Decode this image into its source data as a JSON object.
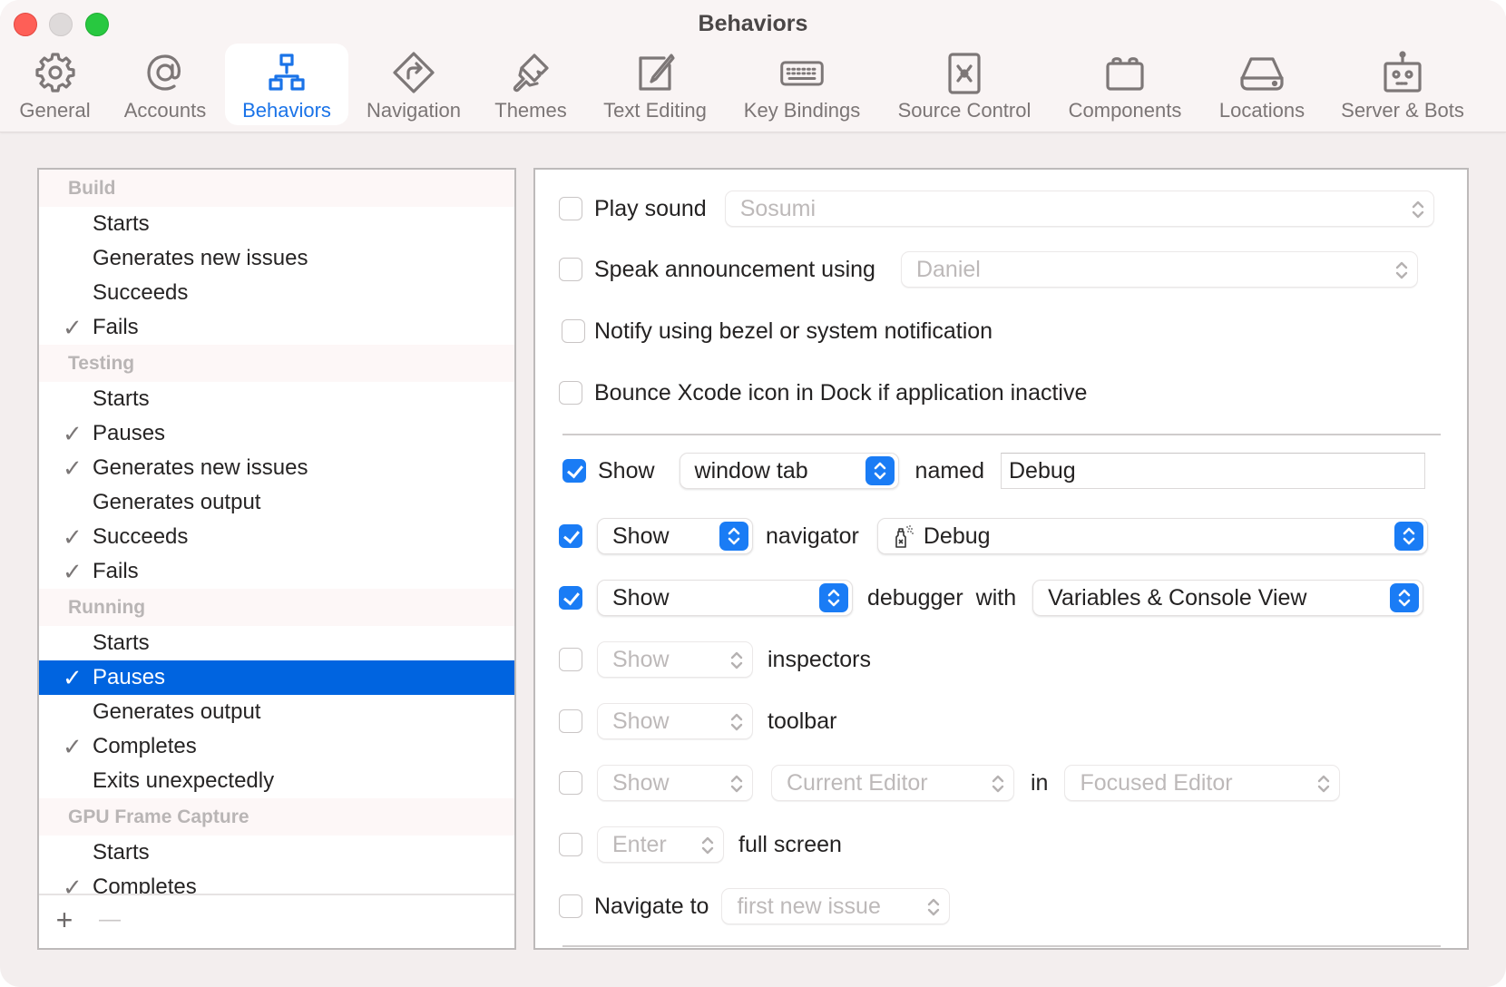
{
  "window": {
    "title": "Behaviors",
    "traffic_lights": [
      "close",
      "minimize",
      "zoom"
    ]
  },
  "toolbar": {
    "tabs": [
      {
        "label": "General",
        "icon": "gear-icon",
        "active": false
      },
      {
        "label": "Accounts",
        "icon": "at-sign-icon",
        "active": false
      },
      {
        "label": "Behaviors",
        "icon": "hierarchy-icon",
        "active": true
      },
      {
        "label": "Navigation",
        "icon": "directions-sign-icon",
        "active": false
      },
      {
        "label": "Themes",
        "icon": "paintbrush-icon",
        "active": false
      },
      {
        "label": "Text Editing",
        "icon": "square-pencil-icon",
        "active": false
      },
      {
        "label": "Key Bindings",
        "icon": "keyboard-icon",
        "active": false
      },
      {
        "label": "Source Control",
        "icon": "source-control-icon",
        "active": false
      },
      {
        "label": "Components",
        "icon": "components-icon",
        "active": false
      },
      {
        "label": "Locations",
        "icon": "drive-icon",
        "active": false
      },
      {
        "label": "Server & Bots",
        "icon": "robot-icon",
        "active": false
      }
    ],
    "accent_color": "#1a73e8"
  },
  "sidebar": {
    "groups": [
      {
        "header": "Build",
        "items": [
          {
            "label": "Starts",
            "checked": false
          },
          {
            "label": "Generates new issues",
            "checked": false
          },
          {
            "label": "Succeeds",
            "checked": false
          },
          {
            "label": "Fails",
            "checked": true
          }
        ]
      },
      {
        "header": "Testing",
        "items": [
          {
            "label": "Starts",
            "checked": false
          },
          {
            "label": "Pauses",
            "checked": true
          },
          {
            "label": "Generates new issues",
            "checked": true
          },
          {
            "label": "Generates output",
            "checked": false
          },
          {
            "label": "Succeeds",
            "checked": true
          },
          {
            "label": "Fails",
            "checked": true
          }
        ]
      },
      {
        "header": "Running",
        "items": [
          {
            "label": "Starts",
            "checked": false
          },
          {
            "label": "Pauses",
            "checked": true,
            "selected": true
          },
          {
            "label": "Generates output",
            "checked": false
          },
          {
            "label": "Completes",
            "checked": true
          },
          {
            "label": "Exits unexpectedly",
            "checked": false
          }
        ]
      },
      {
        "header": "GPU Frame Capture",
        "items": [
          {
            "label": "Starts",
            "checked": false
          },
          {
            "label": "Completes",
            "checked": true
          }
        ]
      }
    ],
    "check_glyph": "✓",
    "add_label": "+",
    "remove_label": "—",
    "selection_color": "#0064e0"
  },
  "panel": {
    "play_sound": {
      "checked": false,
      "label": "Play sound",
      "value": "Sosumi"
    },
    "speak": {
      "checked": false,
      "label": "Speak announcement using",
      "value": "Daniel"
    },
    "notify": {
      "checked": false,
      "label": "Notify using bezel or system notification"
    },
    "bounce": {
      "checked": false,
      "label": "Bounce Xcode icon in Dock if application inactive"
    },
    "show_tab": {
      "checked": true,
      "label": "Show",
      "value": "window tab",
      "named_label": "named",
      "name_value": "Debug"
    },
    "navigator": {
      "checked": true,
      "action": "Show",
      "label": "navigator",
      "value": "Debug",
      "value_icon": "debug-spray-icon"
    },
    "debugger": {
      "checked": true,
      "action": "Show",
      "label": "debugger",
      "with_label": "with",
      "value": "Variables & Console View"
    },
    "inspectors": {
      "checked": false,
      "action": "Show",
      "label": "inspectors"
    },
    "toolbar": {
      "checked": false,
      "action": "Show",
      "label": "toolbar"
    },
    "editor": {
      "checked": false,
      "action": "Show",
      "value": "Current Editor",
      "in_label": "in",
      "target": "Focused Editor"
    },
    "fullscreen": {
      "checked": false,
      "action": "Enter",
      "label": "full screen"
    },
    "navigate": {
      "checked": false,
      "label": "Navigate to",
      "value": "first new issue"
    },
    "checkbox_color": "#1a7cf5"
  }
}
